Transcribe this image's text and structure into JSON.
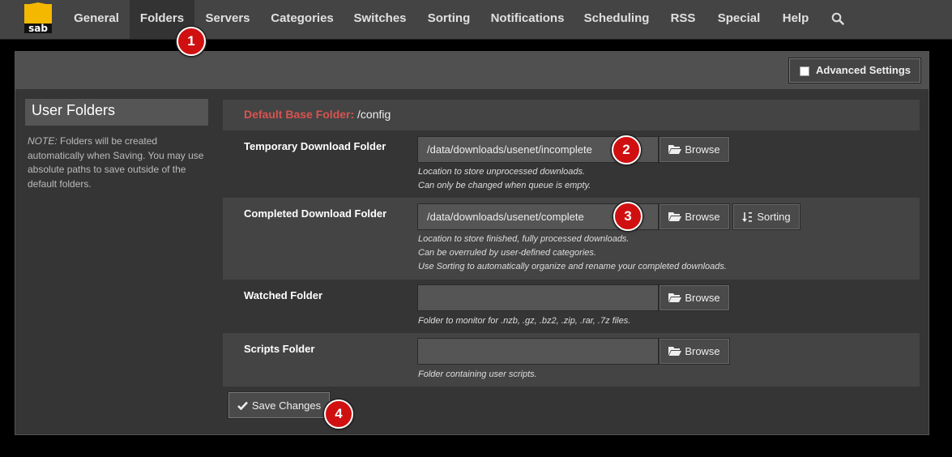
{
  "nav": {
    "items": [
      {
        "label": "General"
      },
      {
        "label": "Folders"
      },
      {
        "label": "Servers"
      },
      {
        "label": "Categories"
      },
      {
        "label": "Switches"
      },
      {
        "label": "Sorting"
      },
      {
        "label": "Notifications"
      },
      {
        "label": "Scheduling"
      },
      {
        "label": "RSS"
      },
      {
        "label": "Special"
      },
      {
        "label": "Help"
      }
    ],
    "active": "Folders",
    "search_icon": "search-icon",
    "logo_text": "sab"
  },
  "header": {
    "advanced_settings_label": "Advanced Settings",
    "advanced_settings_checked": false
  },
  "sidebar": {
    "title": "User Folders",
    "note_label": "NOTE:",
    "note_text": "Folders will be created automatically when Saving. You may use absolute paths to save outside of the default folders."
  },
  "settings": {
    "base_folder_label": "Default Base Folder:",
    "base_folder_value": "/config",
    "temporary": {
      "label": "Temporary Download Folder",
      "value": "/data/downloads/usenet/incomplete",
      "browse_label": "Browse",
      "help": [
        "Location to store unprocessed downloads.",
        "Can only be changed when queue is empty."
      ]
    },
    "completed": {
      "label": "Completed Download Folder",
      "value": "/data/downloads/usenet/complete",
      "browse_label": "Browse",
      "sorting_label": "Sorting",
      "help": [
        "Location to store finished, fully processed downloads.",
        "Can be overruled by user-defined categories.",
        "Use Sorting to automatically organize and rename your completed downloads."
      ]
    },
    "watched": {
      "label": "Watched Folder",
      "value": "",
      "browse_label": "Browse",
      "help": [
        "Folder to monitor for .nzb, .gz, .bz2, .zip, .rar, .7z files."
      ]
    },
    "scripts": {
      "label": "Scripts Folder",
      "value": "",
      "browse_label": "Browse",
      "help": [
        "Folder containing user scripts."
      ]
    }
  },
  "save_label": "Save Changes",
  "badges": [
    "1",
    "2",
    "3",
    "4"
  ],
  "colors": {
    "accent_red": "#d9534f",
    "badge_red": "#d01010",
    "logo_yellow": "#f5b800"
  }
}
